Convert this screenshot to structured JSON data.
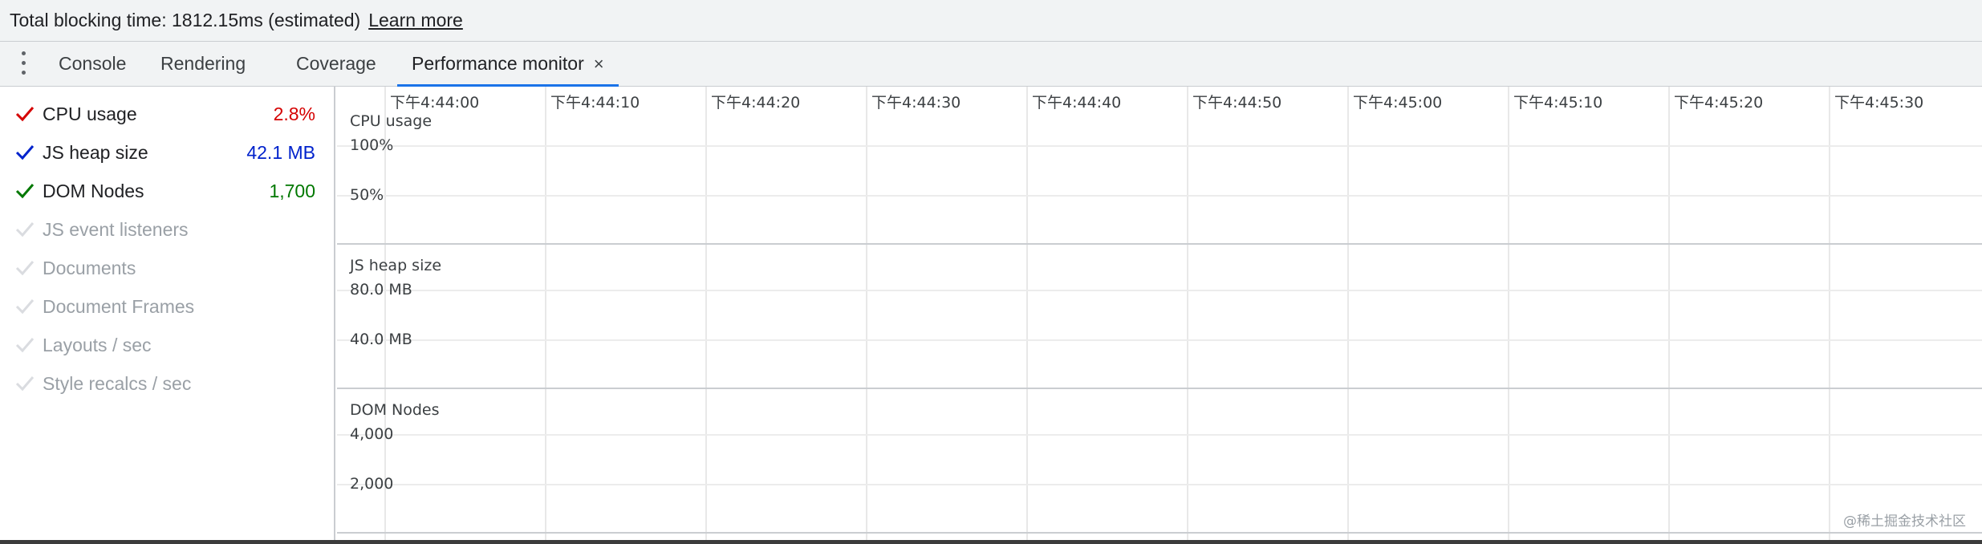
{
  "top_bar": {
    "message": "Total blocking time: 1812.15ms (estimated)",
    "link": "Learn more"
  },
  "tabs": [
    {
      "label": "Console"
    },
    {
      "label": "Rendering"
    },
    {
      "label": "Coverage"
    },
    {
      "label": "Performance monitor",
      "active": true,
      "close_icon": "×"
    }
  ],
  "metrics": [
    {
      "label": "CPU usage",
      "value": "2.8%",
      "checked": true,
      "color": "#d50000"
    },
    {
      "label": "JS heap size",
      "value": "42.1 MB",
      "checked": true,
      "color": "#0022cc"
    },
    {
      "label": "DOM Nodes",
      "value": "1,700",
      "checked": true,
      "color": "#007800"
    },
    {
      "label": "JS event listeners",
      "value": "",
      "checked": false
    },
    {
      "label": "Documents",
      "value": "",
      "checked": false
    },
    {
      "label": "Document Frames",
      "value": "",
      "checked": false
    },
    {
      "label": "Layouts / sec",
      "value": "",
      "checked": false
    },
    {
      "label": "Style recalcs / sec",
      "value": "",
      "checked": false
    }
  ],
  "timeline": {
    "ticks": [
      "下午4:44:00",
      "下午4:44:10",
      "下午4:44:20",
      "下午4:44:30",
      "下午4:44:40",
      "下午4:44:50",
      "下午4:45:00",
      "下午4:45:10",
      "下午4:45:20",
      "下午4:45:30"
    ]
  },
  "graphs": [
    {
      "title": "CPU usage",
      "scale": [
        "100%",
        "50%"
      ]
    },
    {
      "title": "JS heap size",
      "scale": [
        "80.0 MB",
        "40.0 MB"
      ]
    },
    {
      "title": "DOM Nodes",
      "scale": [
        "4,000",
        "2,000"
      ]
    }
  ],
  "watermark": "@稀土掘金技术社区",
  "colors": {
    "toolbar_bg": "#f1f3f4",
    "active_tab_underline": "#1a73e8",
    "grid": "#e8e8e8",
    "disabled_text": "#9aa0a6"
  }
}
